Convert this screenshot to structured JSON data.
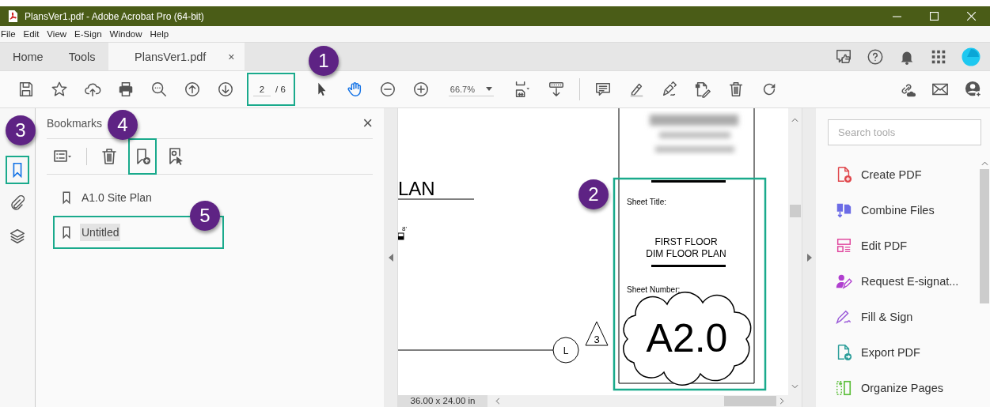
{
  "window": {
    "title": "PlansVer1.pdf - Adobe Acrobat Pro (64-bit)"
  },
  "menu": [
    "File",
    "Edit",
    "View",
    "E-Sign",
    "Window",
    "Help"
  ],
  "tabs": [
    {
      "label": "Home",
      "selected": false
    },
    {
      "label": "Tools",
      "selected": false
    },
    {
      "label": "PlansVer1.pdf",
      "selected": true,
      "close": "×"
    }
  ],
  "toolbar": {
    "page": "2",
    "page_total": "/ 6",
    "highlighted": true,
    "zoom": "66.7%"
  },
  "rail": [
    {
      "kind": "bookmarks",
      "selected": true,
      "highlighted": true
    },
    {
      "kind": "attachments",
      "selected": false,
      "highlighted": false
    },
    {
      "kind": "layers",
      "selected": false,
      "highlighted": false
    }
  ],
  "bookmarks": {
    "title": "Bookmarks",
    "close": "×",
    "tools": [
      {
        "kind": "options",
        "highlighted": false
      },
      {
        "kind": "delete",
        "highlighted": false
      },
      {
        "kind": "new",
        "highlighted": true
      },
      {
        "kind": "find",
        "highlighted": false
      }
    ],
    "items": [
      {
        "label": "A1.0 Site Plan",
        "selected": false,
        "highlighted": false
      },
      {
        "label": "Untitled",
        "selected": true,
        "highlighted": true
      }
    ]
  },
  "document": {
    "heading": "LAN",
    "dimension": "8'",
    "grid_bubble": "L",
    "revision": "3",
    "sheet_title_label": "Sheet Title:",
    "sheet_title": [
      "FIRST FLOOR",
      "DIM FLOOR PLAN"
    ],
    "sheet_number_label": "Sheet Number:",
    "sheet_number": "A2.0",
    "highlighted": true,
    "page_size": "36.00 x 24.00 in"
  },
  "tools_panel": {
    "search": {
      "placeholder": "Search tools"
    },
    "items": [
      {
        "kind": "create",
        "label": "Create PDF",
        "color": "#e0474c"
      },
      {
        "kind": "combine",
        "label": "Combine Files",
        "color": "#6c6ce6"
      },
      {
        "kind": "edit",
        "label": "Edit PDF",
        "color": "#e0479e"
      },
      {
        "kind": "request",
        "label": "Request E-signat...",
        "color": "#b03fcf"
      },
      {
        "kind": "fill",
        "label": "Fill & Sign",
        "color": "#9a5ad8"
      },
      {
        "kind": "export",
        "label": "Export PDF",
        "color": "#2a9d99"
      },
      {
        "kind": "organize",
        "label": "Organize Pages",
        "color": "#5cbf3a"
      }
    ]
  },
  "callouts": [
    {
      "number": "1"
    },
    {
      "number": "2"
    },
    {
      "number": "3"
    },
    {
      "number": "4"
    },
    {
      "number": "5"
    }
  ]
}
